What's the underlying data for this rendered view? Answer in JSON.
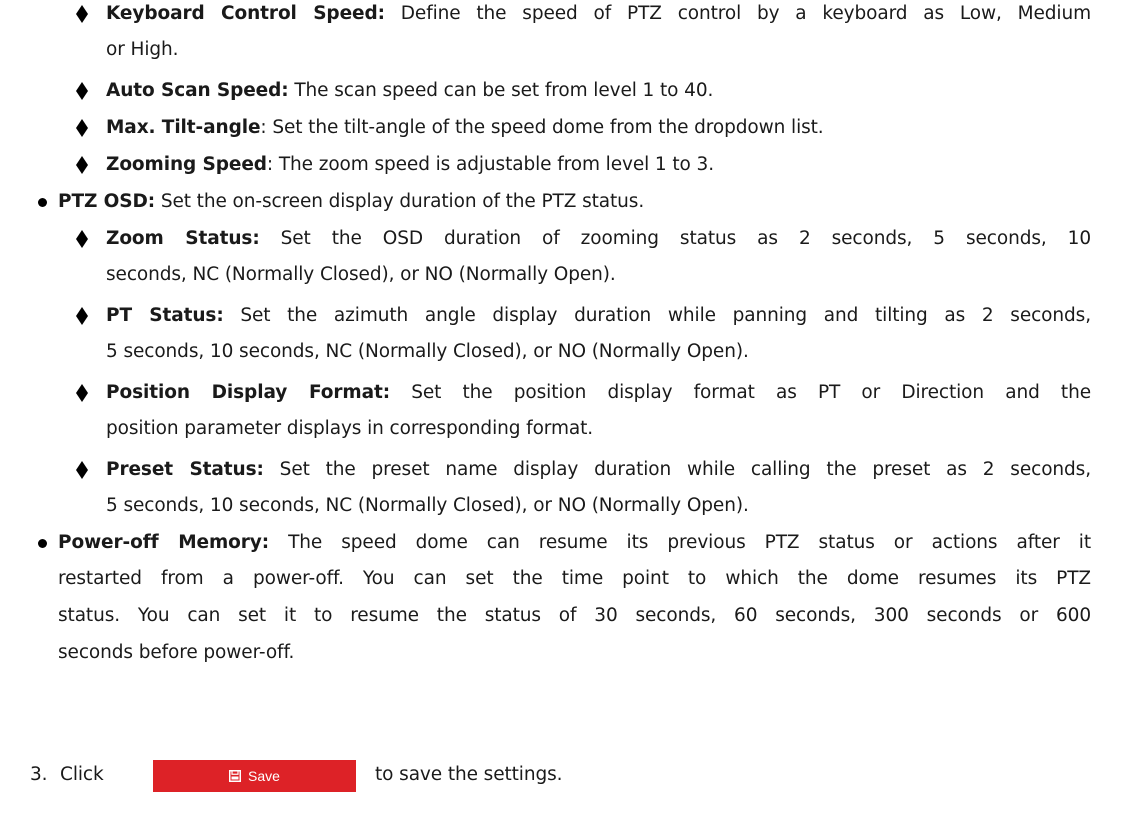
{
  "items": [
    {
      "label": "Keyboard Control Speed:",
      "text": " Define the speed of PTZ control by a keyboard as Low, Medium",
      "cont": "or High."
    },
    {
      "label": "Auto Scan Speed:",
      "text": " The scan speed can be set from level 1 to 40."
    },
    {
      "label": "Max. Tilt-angle",
      "text": ": Set the tilt-angle of the speed dome from the dropdown list."
    },
    {
      "label": "Zooming Speed",
      "text": ": The zoom speed is adjustable from level 1 to 3."
    },
    {
      "label": "PTZ OSD:",
      "text": " Set the on-screen display duration of the PTZ status."
    },
    {
      "label": "Zoom Status:",
      "text": " Set the OSD duration of zooming status as 2 seconds, 5 seconds, 10",
      "cont": "seconds, NC (Normally Closed), or NO (Normally Open)."
    },
    {
      "label": "PT Status:",
      "text": " Set the azimuth angle display duration while panning and tilting as 2 seconds,",
      "cont": "5 seconds, 10 seconds, NC (Normally Closed), or NO (Normally Open)."
    },
    {
      "label": "Position Display Format:",
      "text": " Set the position display format as PT or Direction and the",
      "cont": "position parameter displays in corresponding format."
    },
    {
      "label": "Preset Status:",
      "text": " Set the preset name display duration while calling the preset as 2 seconds,",
      "cont": "5 seconds, 10 seconds, NC (Normally Closed), or NO (Normally Open)."
    },
    {
      "label": "Power-off Memory:",
      "text": " The speed dome can resume its previous PTZ status or actions after it",
      "cont": [
        "restarted from a power-off. You can set the time point to which the dome resumes its PTZ",
        "status. You can set it to resume the status of 30 seconds, 60 seconds, 300 seconds or 600",
        "seconds before power-off."
      ]
    }
  ],
  "step": {
    "number": "3.",
    "click": "Click",
    "after": "to save the settings."
  },
  "save_button": {
    "label": "Save",
    "icon": "save-icon",
    "color": "#dd2227"
  }
}
